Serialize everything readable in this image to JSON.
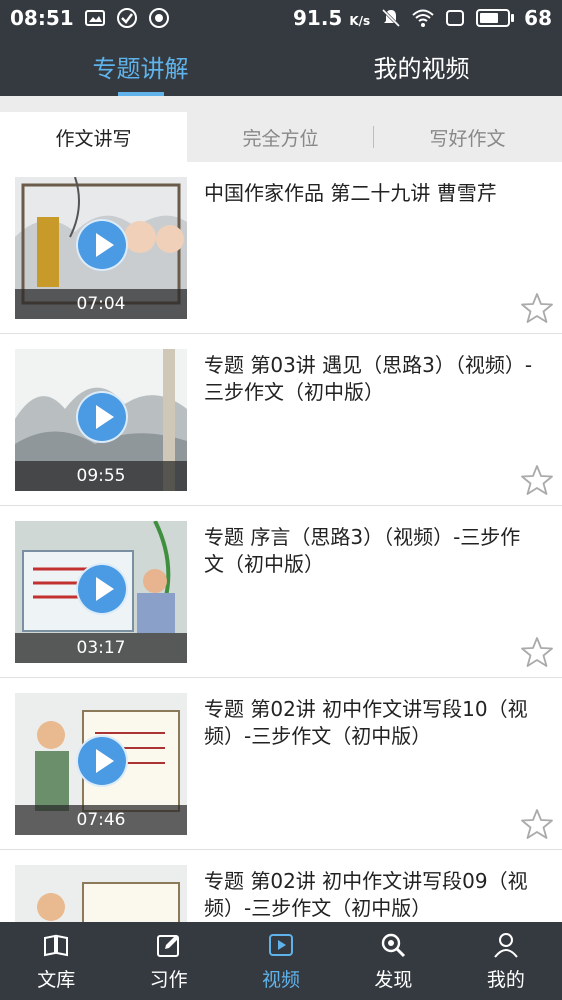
{
  "status_bar": {
    "time": "08:51",
    "speed": "91.5",
    "speed_unit": "K/s",
    "battery": "68",
    "battery_level": 0.68
  },
  "top_tabs": [
    {
      "label": "专题讲解",
      "active": true
    },
    {
      "label": "我的视频",
      "active": false
    }
  ],
  "sub_tabs": [
    {
      "label": "作文讲写",
      "active": true
    },
    {
      "label": "完全方位",
      "active": false
    },
    {
      "label": "写好作文",
      "active": false
    }
  ],
  "videos": [
    {
      "title": "中国作家作品 第二十九讲 曹雪芹",
      "duration": "07:04"
    },
    {
      "title": "专题 第03讲 遇见（思路3）（视频）-三步作文（初中版）",
      "duration": "09:55"
    },
    {
      "title": "专题 序言（思路3）（视频）-三步作文（初中版）",
      "duration": "03:17"
    },
    {
      "title": "专题 第02讲 初中作文讲写段10（视频）-三步作文（初中版）",
      "duration": "07:46"
    },
    {
      "title": "专题 第02讲 初中作文讲写段09（视频）-三步作文（初中版）",
      "duration": ""
    }
  ],
  "bottom_nav": [
    {
      "label": "文库",
      "icon": "book-icon",
      "active": false
    },
    {
      "label": "习作",
      "icon": "edit-icon",
      "active": false
    },
    {
      "label": "视频",
      "icon": "video-play-icon",
      "active": true
    },
    {
      "label": "发现",
      "icon": "discover-icon",
      "active": false
    },
    {
      "label": "我的",
      "icon": "user-icon",
      "active": false
    }
  ],
  "colors": {
    "header_bg": "#353a40",
    "accent": "#5fb3ea",
    "play_button": "#4a9be3"
  }
}
